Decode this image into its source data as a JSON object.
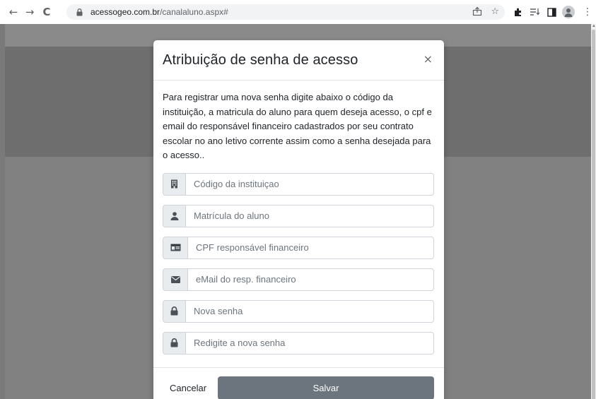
{
  "browser": {
    "url_domain": "acessogeo.com.br",
    "url_path": "/canalaluno.aspx#"
  },
  "modal": {
    "title": "Atribuição de senha de acesso",
    "close_label": "×",
    "intro": "Para registrar uma nova senha digite abaixo o código da instituição, a matricula do aluno para quem deseja acesso, o cpf e email do responsável financeiro cadastrados por seu contrato escolar no ano letivo corrente assim como a senha desejada para o acesso..",
    "fields": [
      {
        "placeholder": "Código da instituiçao",
        "icon": "building-icon"
      },
      {
        "placeholder": "Matrícula do aluno",
        "icon": "user-icon"
      },
      {
        "placeholder": "CPF responsável financeiro",
        "icon": "id-card-icon"
      },
      {
        "placeholder": "eMail do resp. financeiro",
        "icon": "envelope-icon"
      },
      {
        "placeholder": "Nova senha",
        "icon": "lock-icon"
      },
      {
        "placeholder": "Redigite a nova senha",
        "icon": "lock-icon"
      }
    ],
    "cancel_label": "Cancelar",
    "save_label": "Salvar"
  },
  "colors": {
    "save_button": "#6c757d",
    "backdrop": "#7c7c7c",
    "addon_bg": "#e9ecef"
  }
}
